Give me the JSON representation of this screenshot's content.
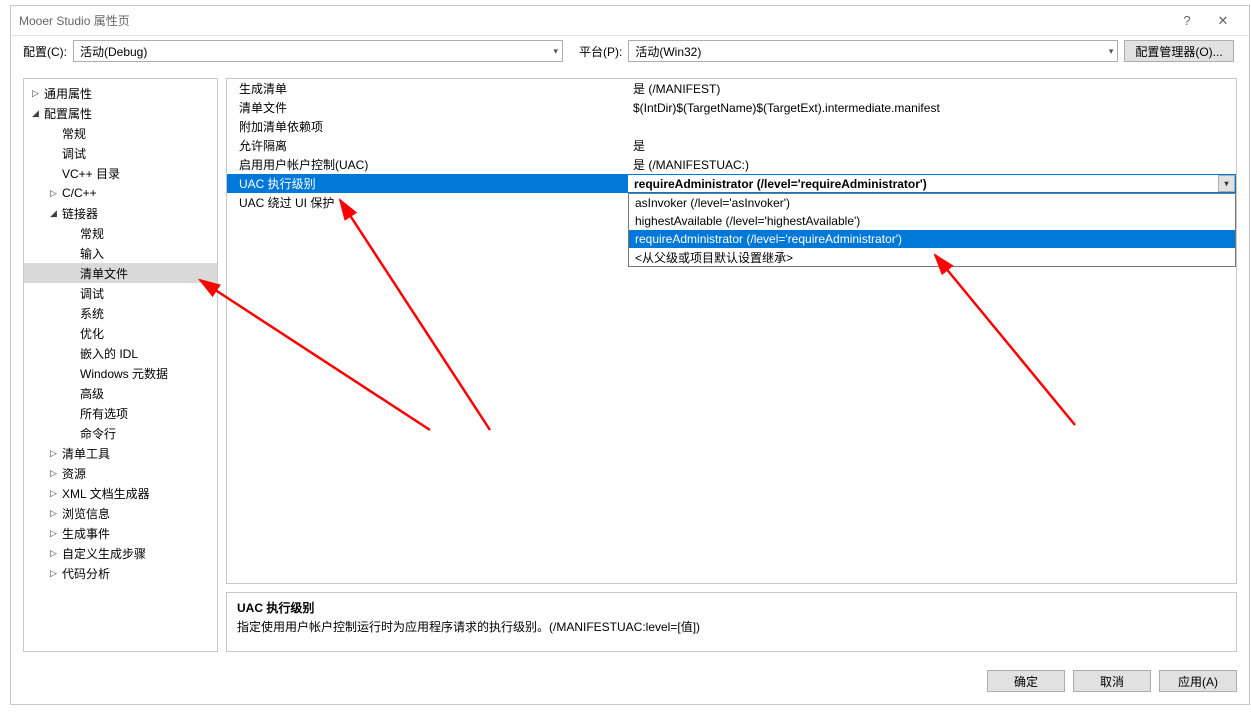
{
  "title": "Mooer Studio 属性页",
  "toprow": {
    "config_label": "配置(C):",
    "config_value": "活动(Debug)",
    "platform_label": "平台(P):",
    "platform_value": "活动(Win32)",
    "cfgmgr_button": "配置管理器(O)..."
  },
  "tree": [
    {
      "label": "通用属性",
      "depth": 0,
      "expand": "▷"
    },
    {
      "label": "配置属性",
      "depth": 0,
      "expand": "◢"
    },
    {
      "label": "常规",
      "depth": 1,
      "expand": ""
    },
    {
      "label": "调试",
      "depth": 1,
      "expand": ""
    },
    {
      "label": "VC++ 目录",
      "depth": 1,
      "expand": ""
    },
    {
      "label": "C/C++",
      "depth": 1,
      "expand": "▷"
    },
    {
      "label": "链接器",
      "depth": 1,
      "expand": "◢"
    },
    {
      "label": "常规",
      "depth": 2,
      "expand": ""
    },
    {
      "label": "输入",
      "depth": 2,
      "expand": ""
    },
    {
      "label": "清单文件",
      "depth": 2,
      "expand": "",
      "sel": true
    },
    {
      "label": "调试",
      "depth": 2,
      "expand": ""
    },
    {
      "label": "系统",
      "depth": 2,
      "expand": ""
    },
    {
      "label": "优化",
      "depth": 2,
      "expand": ""
    },
    {
      "label": "嵌入的 IDL",
      "depth": 2,
      "expand": ""
    },
    {
      "label": "Windows 元数据",
      "depth": 2,
      "expand": ""
    },
    {
      "label": "高级",
      "depth": 2,
      "expand": ""
    },
    {
      "label": "所有选项",
      "depth": 2,
      "expand": ""
    },
    {
      "label": "命令行",
      "depth": 2,
      "expand": ""
    },
    {
      "label": "清单工具",
      "depth": 1,
      "expand": "▷"
    },
    {
      "label": "资源",
      "depth": 1,
      "expand": "▷"
    },
    {
      "label": "XML 文档生成器",
      "depth": 1,
      "expand": "▷"
    },
    {
      "label": "浏览信息",
      "depth": 1,
      "expand": "▷"
    },
    {
      "label": "生成事件",
      "depth": 1,
      "expand": "▷"
    },
    {
      "label": "自定义生成步骤",
      "depth": 1,
      "expand": "▷"
    },
    {
      "label": "代码分析",
      "depth": 1,
      "expand": "▷"
    }
  ],
  "grid": [
    {
      "label": "生成清单",
      "value": "是 (/MANIFEST)"
    },
    {
      "label": "清单文件",
      "value": "$(IntDir)$(TargetName)$(TargetExt).intermediate.manifest"
    },
    {
      "label": "附加清单依赖项",
      "value": ""
    },
    {
      "label": "允许隔离",
      "value": "是"
    },
    {
      "label": "启用用户帐户控制(UAC)",
      "value": "是 (/MANIFESTUAC:)"
    },
    {
      "label": "UAC 执行级别",
      "value": "requireAdministrator (/level='requireAdministrator')",
      "sel": true
    },
    {
      "label": "UAC 绕过 UI 保护",
      "value": ""
    }
  ],
  "dropdown": [
    {
      "label": "asInvoker (/level='asInvoker')"
    },
    {
      "label": "highestAvailable (/level='highestAvailable')"
    },
    {
      "label": "requireAdministrator (/level='requireAdministrator')",
      "sel": true
    },
    {
      "label": "<从父级或项目默认设置继承>"
    }
  ],
  "desc": {
    "title": "UAC 执行级别",
    "body": "指定使用用户帐户控制运行时为应用程序请求的执行级别。(/MANIFESTUAC:level=[值])"
  },
  "footer": {
    "ok": "确定",
    "cancel": "取消",
    "apply": "应用(A)"
  }
}
